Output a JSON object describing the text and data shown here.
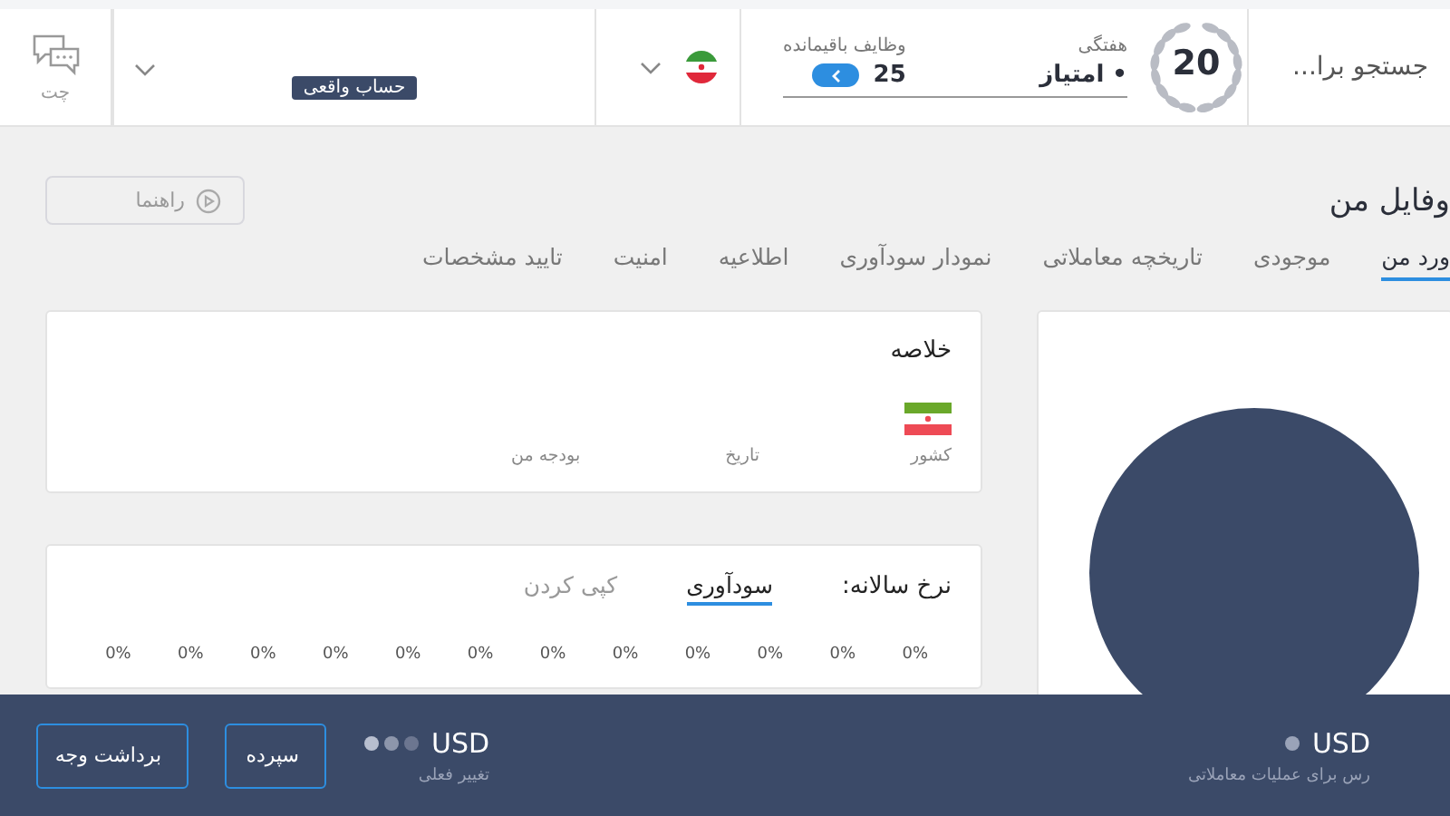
{
  "header": {
    "search": {
      "placeholder": "جستجو برا..."
    },
    "score": {
      "value": "20",
      "period": "هفتگی",
      "points": "• امتیاز"
    },
    "tasks": {
      "label": "وظایف باقیمانده",
      "count": "25"
    },
    "account": {
      "badge": "حساب واقعی"
    },
    "chat": {
      "label": "چت"
    }
  },
  "page": {
    "title": "وفایل من",
    "guide_button": "راهنما"
  },
  "tabs": [
    {
      "label": "ورد من",
      "selected": true
    },
    {
      "label": "موجودی",
      "selected": false
    },
    {
      "label": "تاریخچه معاملاتی",
      "selected": false
    },
    {
      "label": "نمودار سودآوری",
      "selected": false
    },
    {
      "label": "اطلاعیه",
      "selected": false
    },
    {
      "label": "امنیت",
      "selected": false
    },
    {
      "label": "تایید مشخصات",
      "selected": false
    }
  ],
  "summary": {
    "title": "خلاصه",
    "fields": [
      {
        "label": "کشور",
        "kind": "flag"
      },
      {
        "label": "تاریخ",
        "kind": "text"
      },
      {
        "label": "بودجه من",
        "kind": "text"
      }
    ]
  },
  "annual_rate": {
    "label": "نرخ سالانه:",
    "tabs": [
      {
        "label": "سودآوری",
        "selected": true
      },
      {
        "label": "کپی کردن",
        "selected": false
      }
    ],
    "values": [
      "0%",
      "0%",
      "0%",
      "0%",
      "0%",
      "0%",
      "0%",
      "0%",
      "0%",
      "0%",
      "0%",
      "0%"
    ]
  },
  "footer": {
    "balances": [
      {
        "kind": "available",
        "currency": "USD",
        "caption": "رس برای عملیات معاملاتی"
      },
      {
        "kind": "change",
        "currency": "USD",
        "caption": "تغییر فعلی"
      }
    ],
    "buttons": [
      {
        "label": "سپرده"
      },
      {
        "label": "برداشت وجه"
      }
    ]
  }
}
